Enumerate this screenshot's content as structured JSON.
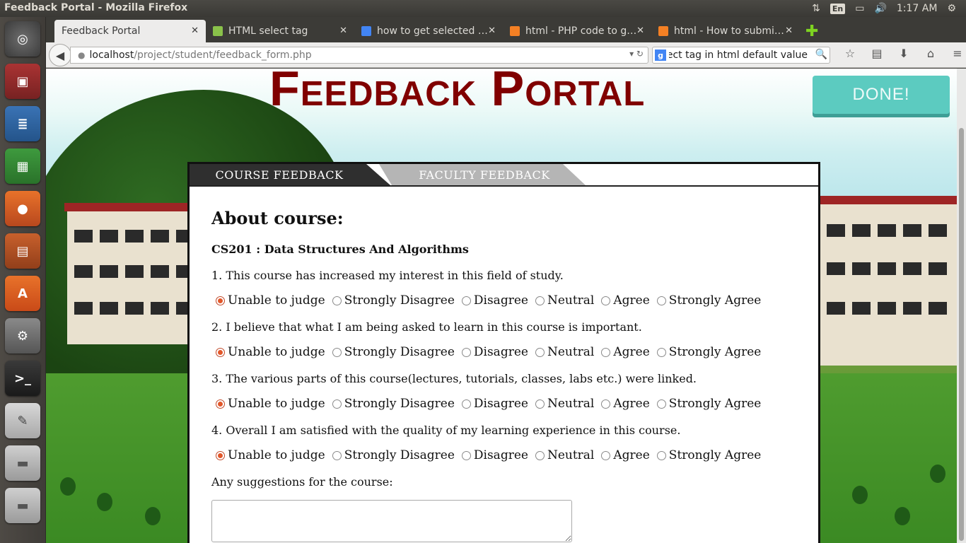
{
  "system": {
    "window_title": "Feedback Portal - Mozilla Firefox",
    "keyboard_layout": "En",
    "clock": "1:17 AM"
  },
  "browser": {
    "tabs": [
      {
        "label": "Feedback Portal",
        "active": true,
        "favicon_color": ""
      },
      {
        "label": "HTML select tag",
        "active": false,
        "favicon_color": "#8ac24a"
      },
      {
        "label": "how to get selected …",
        "active": false,
        "favicon_color": "#4285f4"
      },
      {
        "label": "html - PHP code to g…",
        "active": false,
        "favicon_color": "#f48024"
      },
      {
        "label": "html - How to submi…",
        "active": false,
        "favicon_color": "#f48024"
      }
    ],
    "url_host": "localhost",
    "url_path": "/project/student/feedback_form.php",
    "search_query": "select tag in html default value"
  },
  "page": {
    "portal_title": "Feedback Portal",
    "done_label": "DONE!",
    "tabs": {
      "course": "COURSE FEEDBACK",
      "faculty": "FACULTY FEEDBACK"
    },
    "heading": "About course:",
    "course_name": "CS201 : Data Structures And Algorithms",
    "options": [
      "Unable to judge",
      "Strongly Disagree",
      "Disagree",
      "Neutral",
      "Agree",
      "Strongly Agree"
    ],
    "questions": [
      {
        "text": "1. This course has increased my interest in this field of study.",
        "selected": "Unable to judge"
      },
      {
        "text": "2. I believe that what I am being asked to learn in this course is important.",
        "selected": "Unable to judge"
      },
      {
        "text": "3. The various parts of this course(lectures, tutorials, classes, labs etc.) were linked.",
        "selected": "Unable to judge"
      },
      {
        "text": "4. Overall I am satisfied with the quality of my learning experience in this course.",
        "selected": "Unable to judge"
      }
    ],
    "suggestions_label": "Any suggestions for the course:",
    "suggestions_value": ""
  }
}
